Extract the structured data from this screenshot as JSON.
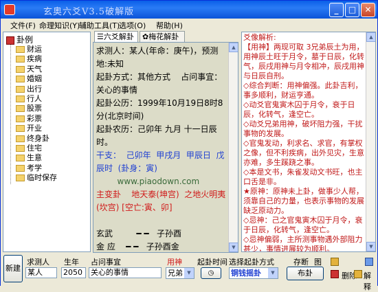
{
  "window": {
    "title": "玄奥六爻V3.5破解版"
  },
  "menu": [
    "文件(F)",
    "命理知识(Y)",
    "辅助工具(T)",
    "选项(O)",
    "帮助(H)"
  ],
  "tree": {
    "root": "卦例",
    "items": [
      "财运",
      "疾病",
      "天气",
      "婚姻",
      "出行",
      "行人",
      "股票",
      "彩票",
      "开业",
      "终身卦",
      "住宅",
      "生意",
      "考学",
      "临时保存"
    ]
  },
  "tabs": [
    "六爻解卦",
    "梅花解卦"
  ],
  "middle": {
    "lines": [
      {
        "text": "求测人：某人(年命：庚午)，预测地:未知",
        "c": ""
      },
      {
        "text": "起卦方式：其他方式    占问事宜：关心的事情",
        "c": ""
      },
      {
        "text": "起卦公历：1999年10月19日8时8分(北京时间)",
        "c": ""
      },
      {
        "text": "起卦农历：己卯年 九月 十一日辰时。",
        "c": ""
      },
      {
        "text": "干支：  己卯年  甲戌月  甲辰日  戊辰时  (卦身：寅)",
        "c": "blue"
      },
      {
        "text": "        www.piaodown.com",
        "c": "wm"
      },
      {
        "text": "主变卦    地天泰(坤宫)  之地火明夷(坎宫) [空亡:寅、卯]",
        "c": "red"
      },
      {
        "text": " ",
        "c": ""
      },
      {
        "text": "玄武         ━ ━   子孙酉",
        "c": ""
      },
      {
        "text": "金 应    ━ ━   子孙酉金",
        "c": ""
      },
      {
        "text": " ",
        "c": ""
      },
      {
        "text": "白虎         ━ ━   妻财亥",
        "c": ""
      },
      {
        "text": "水           妻财亥水",
        "c": ""
      }
    ]
  },
  "right": {
    "lines": [
      {
        "t": "爻像解析:",
        "c": ""
      },
      {
        "t": "【用神】两现可取 3兄弟辰土为用，用神辰土旺于月令，墓于日辰，化转气，辰戌用神与月令相冲，辰戌用神与日辰自刑。",
        "c": ""
      },
      {
        "t": "  ◇综合判断：用神偏强。此卦吉利，事多顺利，财运亨通。",
        "c": ""
      },
      {
        "t": "  ◇动爻官鬼寅木囚于月令，衰于日辰，化转气，逢空亡。",
        "c": ""
      },
      {
        "t": "  ◇动爻兄弟用神，破坏阻力强，干扰事物的发展。",
        "c": ""
      },
      {
        "t": "  ◇官鬼发动，利求名、求官，有掌权之像，但不利疾病，出外见灾，生意亦难，多生蹊跷之事。",
        "c": ""
      },
      {
        "t": "  ◇本是文书，朱雀发动文书旺，也主口舌是非。",
        "c": ""
      },
      {
        "t": "★原神：原神未上卦，做事少人帮，须靠自己的力量，也表示事物的发展缺乏原动力。",
        "c": ""
      },
      {
        "t": "  ◇忌神：己之官鬼寅木囚于月令，衰于日辰，化转气，逢空亡。",
        "c": ""
      },
      {
        "t": "  ◇忌神偏弱，主所测事物遇外部阻力甚少，事情进展较为顺利。",
        "c": ""
      },
      {
        "t": "【世爻】兄弟辰土旺于月令，墓于日辰，化转气，辰戌世爻与月令相冲，辰戌世爻与日辰自刑。",
        "c": ""
      }
    ]
  },
  "bottom": {
    "new_btn": "新建",
    "person_label": "求测人",
    "person_value": "某人",
    "year_label": "生年",
    "year_value": "2050",
    "question_label": "占问事宜",
    "question_value": "关心的事情",
    "yongshen_label": "用神",
    "yongshen_value": "兄弟",
    "time_label": "起卦时间",
    "method_label": "选择起卦方式",
    "method_value": "铜钱摇卦",
    "save_label": "存断",
    "chart_label": "图",
    "cast_btn": "布卦",
    "delete_label": "删除",
    "explain_label": "解释"
  }
}
